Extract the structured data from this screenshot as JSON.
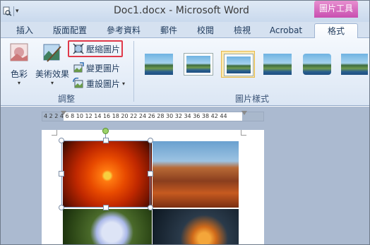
{
  "window": {
    "title": "Doc1.docx - Microsoft Word",
    "context_tab_header": "圖片工具"
  },
  "tabs": [
    {
      "label": "插入"
    },
    {
      "label": "版面配置"
    },
    {
      "label": "參考資料"
    },
    {
      "label": "郵件"
    },
    {
      "label": "校閱"
    },
    {
      "label": "檢視"
    },
    {
      "label": "Acrobat"
    },
    {
      "label": "格式",
      "active": true
    }
  ],
  "ribbon": {
    "adjust_group": {
      "label": "調整",
      "color_label": "色彩",
      "artistic_label": "美術效果",
      "compress_label": "壓縮圖片",
      "change_label": "變更圖片",
      "reset_label": "重設圖片"
    },
    "styles_group": {
      "label": "圖片樣式",
      "thumbnails": [
        "style-1",
        "style-2",
        "style-3",
        "style-4",
        "style-5",
        "style-6"
      ]
    }
  },
  "ruler": {
    "text": "4 2  2  4  6  8 10 12 14 16 18 20 22 24 26 28 30 32 34 36 38   42 44"
  },
  "document": {
    "images": [
      "flower",
      "desert",
      "hydrangea",
      "jellyfish"
    ]
  },
  "colors": {
    "context_accent": "#c84fb0",
    "highlight_border": "#e0394a",
    "doc_background": "#abbad0"
  }
}
